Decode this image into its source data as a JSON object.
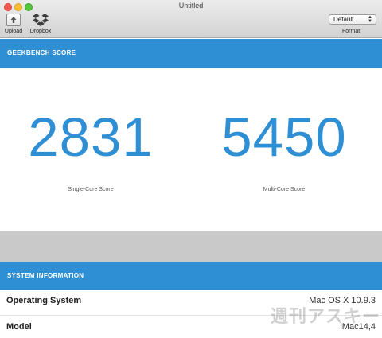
{
  "window": {
    "title": "Untitled"
  },
  "toolbar": {
    "upload_label": "Upload",
    "dropbox_label": "Dropbox",
    "format_value": "Default",
    "format_label": "Format"
  },
  "geekbench": {
    "section_title": "GEEKBENCH SCORE",
    "single_core_score": "2831",
    "single_core_caption": "Single-Core Score",
    "multi_core_score": "5450",
    "multi_core_caption": "Multi-Core Score"
  },
  "system_info": {
    "section_title": "SYSTEM INFORMATION",
    "rows": [
      {
        "label": "Operating System",
        "value": "Mac OS X 10.9.3"
      },
      {
        "label": "Model",
        "value": "iMac14,4"
      }
    ]
  },
  "watermark": "週刊アスキー",
  "colors": {
    "accent": "#2f8fd5",
    "gray_strip": "#c9c9c9"
  }
}
